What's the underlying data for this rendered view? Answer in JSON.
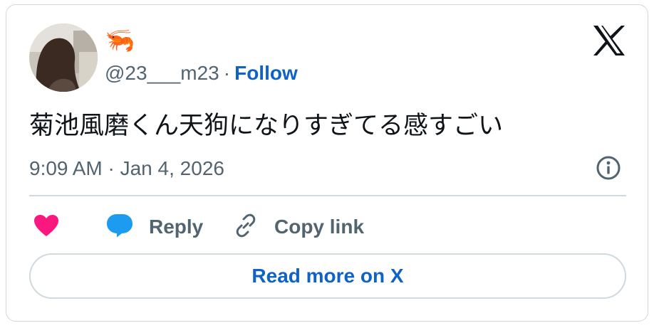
{
  "author": {
    "display_name": "🦐",
    "handle": "@23___m23",
    "separator": "·",
    "follow_label": "Follow"
  },
  "tweet": {
    "text": "菊池風磨くん天狗になりすぎてる感すごい",
    "timestamp": "9:09 AM · Jan 4, 2026"
  },
  "actions": {
    "reply_label": "Reply",
    "copy_link_label": "Copy link"
  },
  "read_more_label": "Read more on X",
  "icons": {
    "brand": "x-logo-icon",
    "info": "info-icon",
    "like": "heart-icon",
    "reply": "speech-bubble-icon",
    "copy": "link-icon"
  },
  "colors": {
    "accent": "#0f63c6",
    "heart": "#f91880",
    "reply_bubble": "#1d9bf0",
    "secondary_text": "#536471",
    "border": "#cfd9de"
  }
}
